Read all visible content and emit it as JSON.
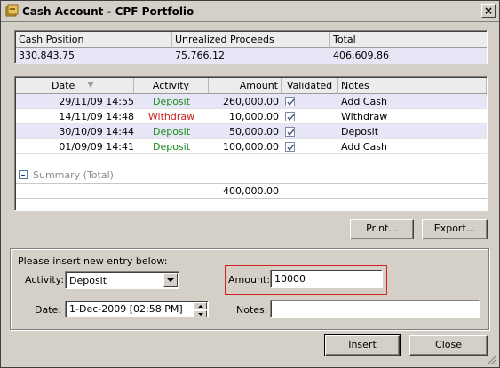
{
  "window": {
    "title": "Cash Account - CPF Portfolio",
    "close_glyph": "×"
  },
  "cash_summary": {
    "headers": [
      "Cash Position",
      "Unrealized Proceeds",
      "Total"
    ],
    "values": [
      "330,843.75",
      "75,766.12",
      "406,609.86"
    ]
  },
  "transactions": {
    "headers": {
      "date": "Date",
      "activity": "Activity",
      "amount": "Amount",
      "validated": "Validated",
      "notes": "Notes"
    },
    "rows": [
      {
        "date": "29/11/09 14:55",
        "activity": "Deposit",
        "amount": "260,000.00",
        "validated": true,
        "notes": "Add Cash"
      },
      {
        "date": "14/11/09 14:48",
        "activity": "Withdraw",
        "amount": "10,000.00",
        "validated": true,
        "notes": "Withdraw"
      },
      {
        "date": "30/10/09 14:44",
        "activity": "Deposit",
        "amount": "50,000.00",
        "validated": true,
        "notes": "Deposit"
      },
      {
        "date": "01/09/09 14:41",
        "activity": "Deposit",
        "amount": "100,000.00",
        "validated": true,
        "notes": "Add Cash"
      }
    ],
    "summary_label": "Summary (Total)",
    "summary_total": "400,000.00"
  },
  "toolbar": {
    "print_label": "Print...",
    "export_label": "Export..."
  },
  "entry_form": {
    "prompt": "Please insert new entry below:",
    "activity_label": "Activity:",
    "activity_value": "Deposit",
    "amount_label": "Amount:",
    "amount_value": "10000",
    "date_label": "Date:",
    "date_value": "1-Dec-2009 [02:58 PM]",
    "notes_label": "Notes:",
    "notes_value": ""
  },
  "actions": {
    "insert_label": "Insert",
    "close_label": "Close"
  },
  "colors": {
    "deposit": "#1a8a1a",
    "withdraw": "#cc2020",
    "row_highlight": "#e6e6f6",
    "amount_highlight_border": "#d22020"
  }
}
